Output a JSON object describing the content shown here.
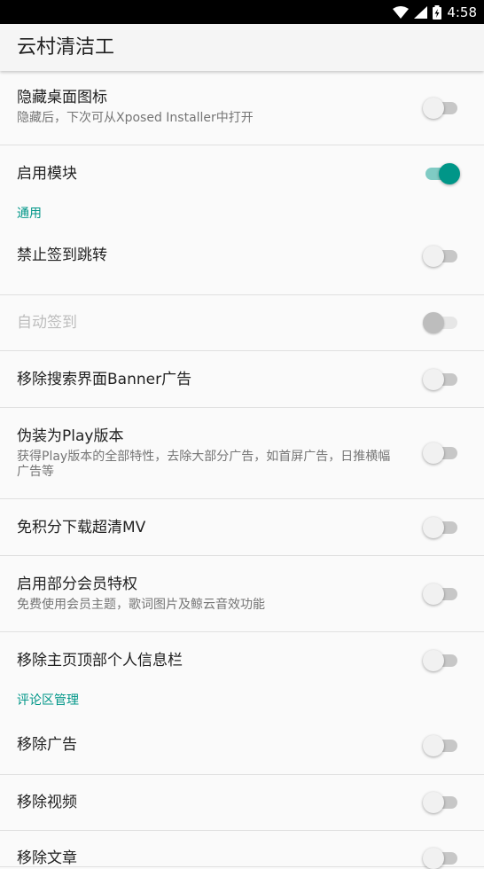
{
  "status_bar": {
    "time": "4:58"
  },
  "app_bar": {
    "title": "云村清洁工"
  },
  "preferences": {
    "hide_icon": {
      "title": "隐藏桌面图标",
      "summary": "隐藏后，下次可从Xposed Installer中打开",
      "checked": false
    },
    "enable_module": {
      "title": "启用模块",
      "checked": true
    },
    "category_general": "通用",
    "disable_signin_jump": {
      "title": "禁止签到跳转",
      "checked": false
    },
    "auto_signin": {
      "title": "自动签到",
      "checked": false,
      "enabled": false
    },
    "remove_search_banner": {
      "title": "移除搜索界面Banner广告",
      "checked": false
    },
    "fake_play": {
      "title": "伪装为Play版本",
      "summary": "获得Play版本的全部特性，去除大部分广告，如首屏广告，日推横幅广告等",
      "checked": false
    },
    "free_mv": {
      "title": "免积分下载超清MV",
      "checked": false
    },
    "vip_features": {
      "title": "启用部分会员特权",
      "summary": "免费使用会员主题，歌词图片及鲸云音效功能",
      "checked": false
    },
    "remove_profile_bar": {
      "title": "移除主页顶部个人信息栏",
      "checked": false
    },
    "category_comments": "评论区管理",
    "remove_ads": {
      "title": "移除广告",
      "checked": false
    },
    "remove_video": {
      "title": "移除视频",
      "checked": false
    },
    "remove_article": {
      "title": "移除文章",
      "checked": false
    }
  },
  "colors": {
    "accent": "#009688",
    "accent_track": "#80cbc4",
    "divider": "#e0e0e0"
  }
}
